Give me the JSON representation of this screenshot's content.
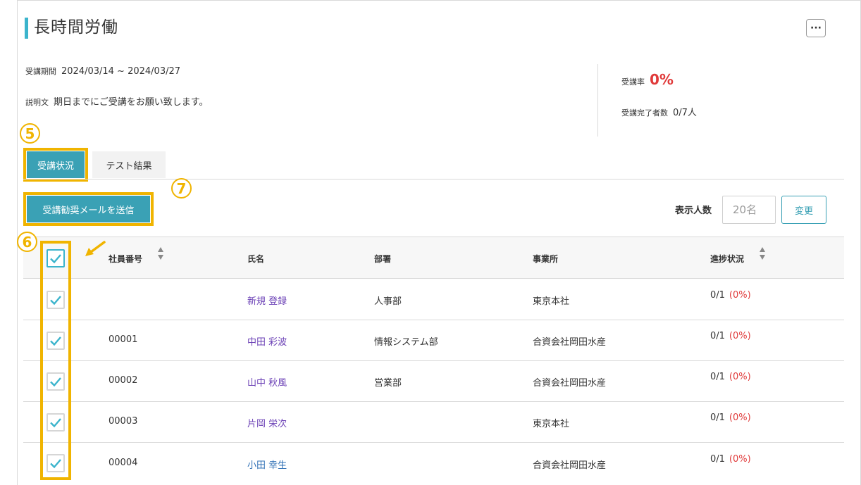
{
  "header": {
    "title": "長時間労働",
    "more_label": "···"
  },
  "period": {
    "label": "受講期間",
    "value": "2024/03/14 ~ 2024/03/27"
  },
  "description": {
    "label": "説明文",
    "value": "期日までにご受講をお願い致します。"
  },
  "stats": {
    "rate_label": "受講率",
    "rate_value": "0%",
    "done_label": "受講完了者数",
    "done_value": "0/7人"
  },
  "callouts": {
    "c5": "5",
    "c6": "6",
    "c7": "7"
  },
  "tabs": {
    "active": "受講状況",
    "inactive": "テスト結果"
  },
  "actions": {
    "mail_button": "受講勧奨メールを送信"
  },
  "display_count": {
    "label": "表示人数",
    "placeholder": "20名",
    "change_label": "変更"
  },
  "table": {
    "columns": {
      "id": "社員番号",
      "name": "氏名",
      "dept": "部署",
      "office": "事業所",
      "progress": "進捗状況"
    },
    "rows": [
      {
        "id": "",
        "name": "新規 登録",
        "dept": "人事部",
        "office": "東京本社",
        "progress": "0/1",
        "pct": "(0%)"
      },
      {
        "id": "00001",
        "name": "中田 彩波",
        "dept": "情報システム部",
        "office": "合資会社岡田水産",
        "progress": "0/1",
        "pct": "(0%)"
      },
      {
        "id": "00002",
        "name": "山中 秋風",
        "dept": "営業部",
        "office": "合資会社岡田水産",
        "progress": "0/1",
        "pct": "(0%)"
      },
      {
        "id": "00003",
        "name": "片岡 栄次",
        "dept": "",
        "office": "東京本社",
        "progress": "0/1",
        "pct": "(0%)"
      },
      {
        "id": "00004",
        "name": "小田 幸生",
        "dept": "",
        "office": "合資会社岡田水産",
        "progress": "0/1",
        "pct": "(0%)"
      }
    ]
  },
  "colors": {
    "accent": "#3aa1b5",
    "highlight": "#f0b400",
    "alert": "#e03a3a"
  }
}
